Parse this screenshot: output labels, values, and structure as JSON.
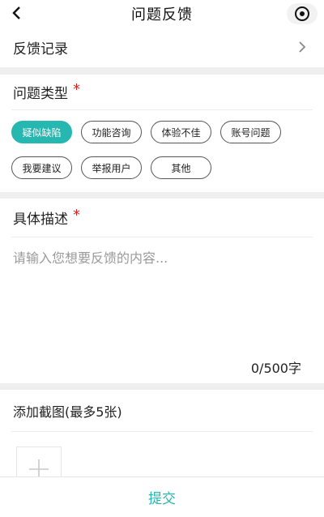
{
  "header": {
    "title": "问题反馈",
    "back_icon": "chevron-left-icon",
    "capsule_icon": "target-icon"
  },
  "record": {
    "label": "反馈记录",
    "arrow_icon": "chevron-right-icon"
  },
  "issue_type": {
    "title": "问题类型",
    "required_mark": "*",
    "tags": [
      "疑似缺陷",
      "功能咨询",
      "体验不佳",
      "账号问题",
      "我要建议",
      "举报用户",
      "其他"
    ],
    "selected": "疑似缺陷"
  },
  "description": {
    "title": "具体描述",
    "required_mark": "*",
    "placeholder": "请输入您想要反馈的内容...",
    "value": "",
    "counter": "0/500字"
  },
  "screenshots": {
    "title": "添加截图(最多5张)",
    "add_icon": "plus-icon"
  },
  "submit": {
    "label": "提交"
  },
  "colors": {
    "accent": "#26b7b0",
    "required": "#e02020"
  }
}
